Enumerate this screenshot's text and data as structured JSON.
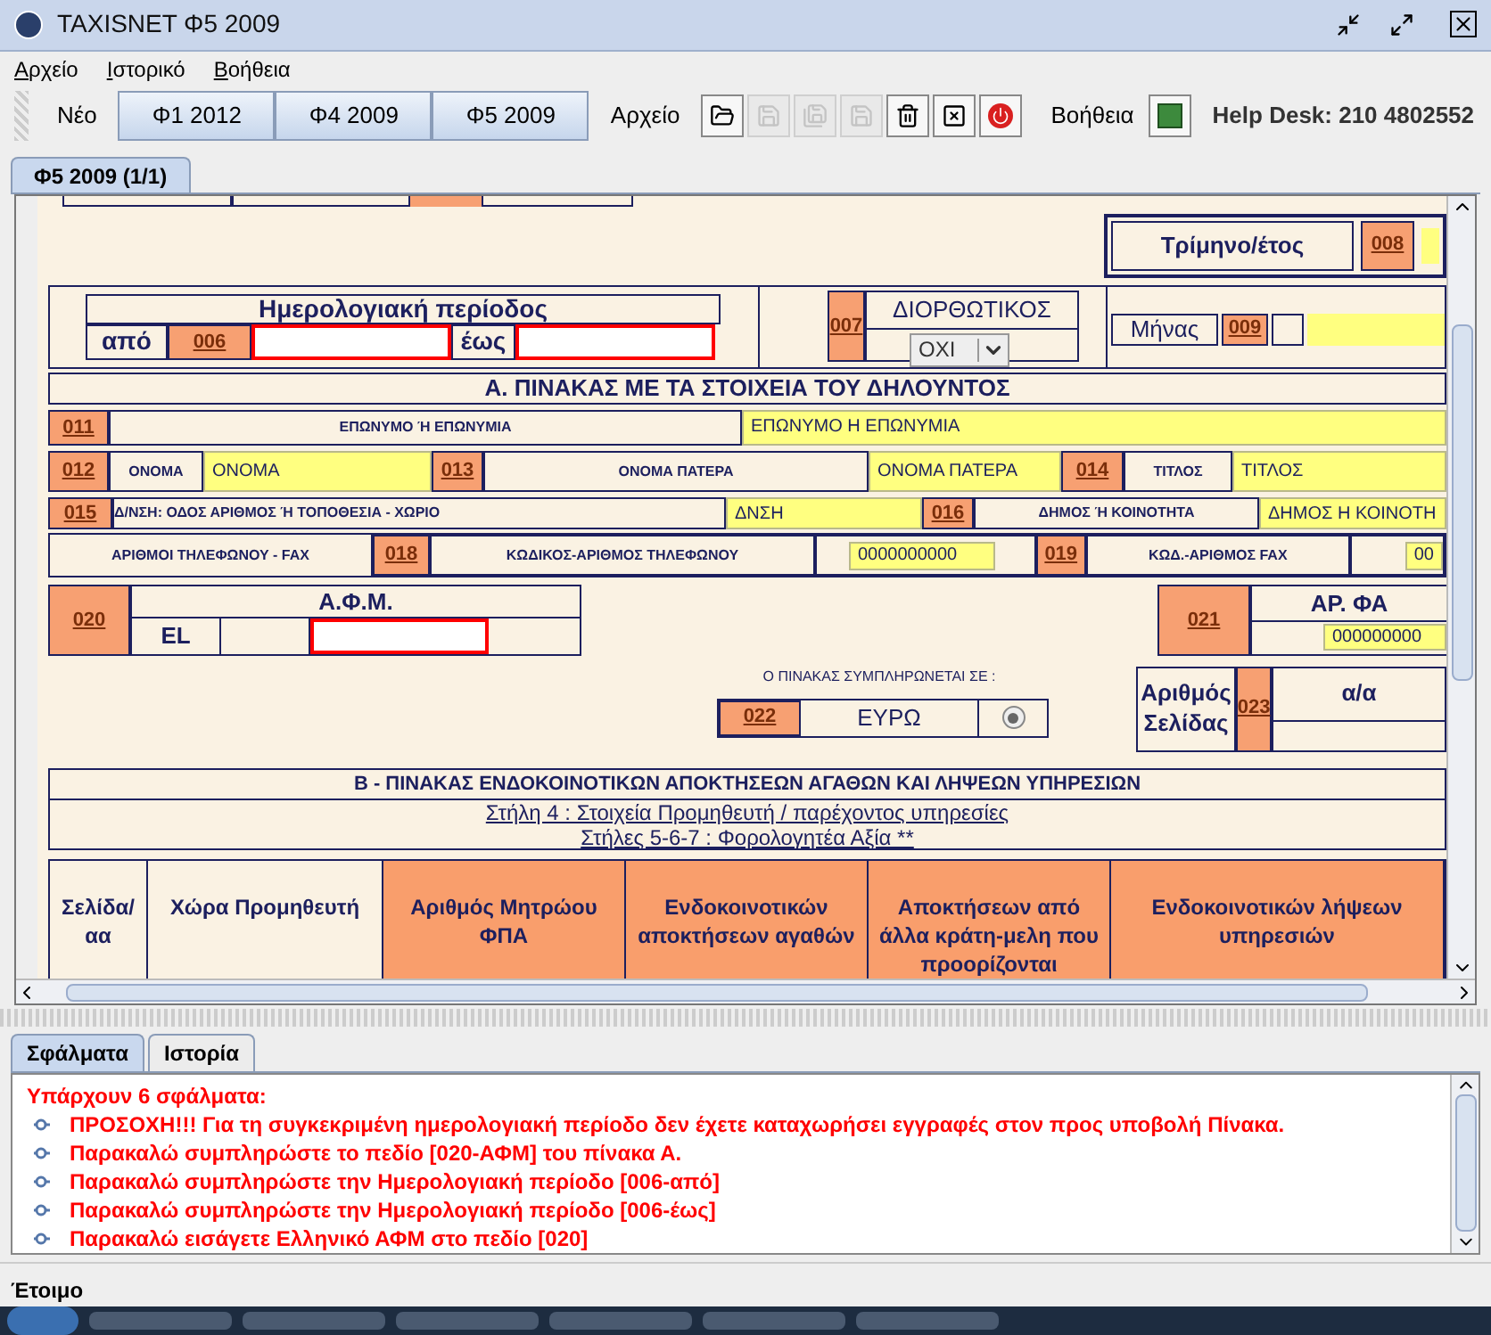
{
  "window": {
    "title": "TAXISNET Φ5 2009"
  },
  "menu": [
    {
      "label": "Αρχείο"
    },
    {
      "label": "Ιστορικό"
    },
    {
      "label": "Βοήθεια"
    }
  ],
  "toolbar": {
    "new_label": "Νέο",
    "form_buttons": [
      "Φ1 2012",
      "Φ4 2009",
      "Φ5 2009"
    ],
    "file_label": "Αρχείο",
    "file_tools": [
      {
        "kind": "open",
        "disabled": false
      },
      {
        "kind": "save",
        "disabled": true
      },
      {
        "kind": "save-all",
        "disabled": true
      },
      {
        "kind": "save",
        "disabled": true
      },
      {
        "kind": "delete",
        "disabled": false
      },
      {
        "kind": "close",
        "disabled": false
      },
      {
        "kind": "exit",
        "disabled": false
      }
    ],
    "help_label": "Βοήθεια",
    "helpdesk": "Help Desk: 210 4802552"
  },
  "document_tabs": [
    {
      "label": "Φ5 2009 (1/1)",
      "selected": true
    }
  ],
  "form": {
    "quarter": {
      "label": "Τρίμηνο/έτος",
      "code": "008"
    },
    "period": {
      "title": "Ημερολογιακή περίοδος",
      "from_label": "από",
      "code": "006",
      "to_label": "έως",
      "from_error": true,
      "to_error": true
    },
    "corrective": {
      "code": "007",
      "title": "ΔΙΟΡΘΩΤΙΚΟΣ",
      "value": "ΟΧΙ"
    },
    "month": {
      "label": "Μήνας",
      "code": "009"
    },
    "section_a": "Α. ΠΙΝΑΚΑΣ ΜΕ ΤΑ ΣΤΟΙΧΕΙΑ ΤΟΥ ΔΗΛΟΥΝΤΟΣ",
    "surname": {
      "code": "011",
      "label": "ΕΠΩΝΥΜΟ Ή ΕΠΩΝΥΜΙΑ",
      "value": "ΕΠΩΝΥΜΟ Η ΕΠΩΝΥΜΙΑ"
    },
    "name_row": [
      {
        "code": "012",
        "label": "ΟΝΟΜΑ",
        "value": "ΟΝΟΜΑ"
      },
      {
        "code": "013",
        "label": "ΟΝΟΜΑ ΠΑΤΕΡΑ",
        "value": "ΟΝΟΜΑ ΠΑΤΕΡΑ"
      },
      {
        "code": "014",
        "label": "ΤΙΤΛΟΣ",
        "value": "ΤΙΤΛΟΣ"
      }
    ],
    "address_row": [
      {
        "code": "015",
        "label": "Δ/ΝΣΗ: ΟΔΟΣ ΑΡΙΘΜΟΣ Ή ΤΟΠΟΘΕΣΙΑ - ΧΩΡΙΟ",
        "value": "ΔΝΣΗ"
      },
      {
        "code": "016",
        "label": "ΔΗΜΟΣ Ή ΚΟΙΝΟΤΗΤΑ",
        "value": "ΔΗΜΟΣ Η ΚΟΙΝΟΤΗ"
      }
    ],
    "phone_row": {
      "label": "ΑΡΙΘΜΟΙ ΤΗΛΕΦΩΝΟΥ - FAX",
      "fields": [
        {
          "code": "018",
          "label": "ΚΩΔΙΚΟΣ-ΑΡΙΘΜΟΣ ΤΗΛΕΦΩΝΟΥ",
          "value": "0000000000"
        },
        {
          "code": "019",
          "label": "ΚΩΔ.-ΑΡΙΘΜΟΣ FAX",
          "value": "00"
        }
      ]
    },
    "afm": {
      "code": "020",
      "title": "Α.Φ.Μ.",
      "prefix": "EL",
      "error": true
    },
    "ar_fa": {
      "code": "021",
      "title": "ΑΡ. ΦΑ",
      "value": "000000000"
    },
    "currency": {
      "caption": "Ο ΠΙΝΑΚΑΣ ΣΥΜΠΛΗΡΩΝΕΤΑΙ ΣΕ :",
      "code": "022",
      "value": "ΕΥΡΩ",
      "selected": true
    },
    "page": {
      "label": "Αριθμός Σελίδας",
      "code": "023",
      "heading": "α/α"
    },
    "section_b": {
      "title": "Β - ΠΙΝΑΚΑΣ ΕΝΔΟΚΟΙΝΟΤΙΚΩΝ ΑΠΟΚΤΗΣΕΩΝ ΑΓΑΘΩΝ ΚΑΙ ΛΗΨΕΩΝ ΥΠΗΡΕΣΙΩΝ",
      "lines": [
        "Στήλη 4 : Στοιχεία Προμηθευτή / παρέχοντος υπηρεσίες",
        "Στήλες 5-6-7 : Φορολογητέα Αξία **"
      ]
    },
    "columns": [
      {
        "label": "Σελίδα/αα",
        "highlight": false
      },
      {
        "label": "Χώρα Προμηθευτή",
        "highlight": false
      },
      {
        "label": "Αριθμός Μητρώου ΦΠΑ",
        "highlight": true
      },
      {
        "label": "Ενδοκοινοτικών αποκτήσεων αγαθών",
        "highlight": true
      },
      {
        "label": "Αποκτήσεων από άλλα κράτη-μελη που προορίζονται",
        "highlight": true
      },
      {
        "label": "Ενδοκοινοτικών λήψεων υπηρεσιών",
        "highlight": true
      }
    ]
  },
  "bottom_tabs": [
    {
      "label": "Σφάλματα",
      "selected": true
    },
    {
      "label": "Ιστορία",
      "selected": false
    }
  ],
  "errors": {
    "heading": "Υπάρχουν 6 σφάλματα:",
    "items": [
      "ΠΡΟΣΟΧΗ!!! Για τη συγκεκριμένη ημερολογιακή περίοδο δεν έχετε καταχωρήσει εγγραφές στον προς υποβολή Πίνακα.",
      "Παρακαλώ συμπληρώστε το πεδίο [020-ΑΦΜ] του πίνακα Α.",
      "Παρακαλώ συμπληρώστε την Ημερολογιακή περίοδο [006-από]",
      "Παρακαλώ συμπληρώστε την Ημερολογιακή περίοδο [006-έως]",
      "Παρακαλώ εισάγετε Ελληνικό ΑΦΜ στο πεδίο [020]"
    ]
  },
  "status_bar": "Έτοιμο"
}
